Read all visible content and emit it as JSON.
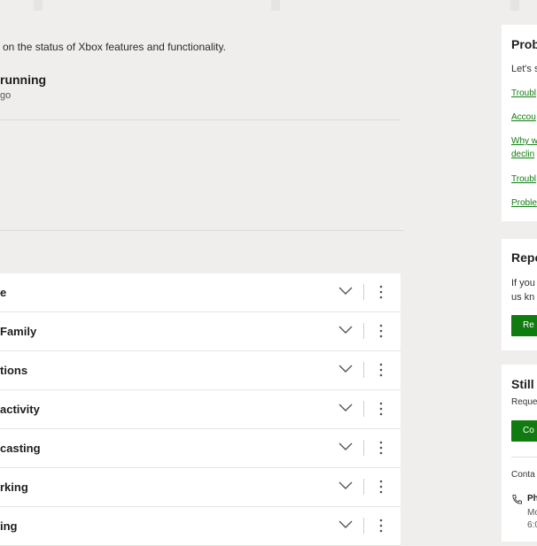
{
  "header": {
    "subtitle": "on the status of Xbox features and functionality."
  },
  "status": {
    "title": "running",
    "subtitle": "go"
  },
  "features": [
    {
      "label": "e"
    },
    {
      "label": "Family"
    },
    {
      "label": "tions"
    },
    {
      "label": "activity"
    },
    {
      "label": "casting"
    },
    {
      "label": "rking"
    },
    {
      "label": "ing"
    }
  ],
  "sidebar": {
    "problems_card": {
      "title": "Prob",
      "intro": "Let's s",
      "links": [
        "Troubl",
        "Accou",
        "Why w",
        "declin",
        "Troubl",
        "Proble"
      ]
    },
    "report_card": {
      "title": "Repo",
      "text_line1": "If you",
      "text_line2": "us kn",
      "button": "Re"
    },
    "still_card": {
      "title": "Still n",
      "text": "Reque",
      "button": "Co",
      "contact_label": "Conta",
      "phone_title": "Ph",
      "phone_line1": "Mo",
      "phone_line2": "6:0"
    }
  },
  "colors": {
    "background": "#f0eeed",
    "accent": "#107c10"
  }
}
